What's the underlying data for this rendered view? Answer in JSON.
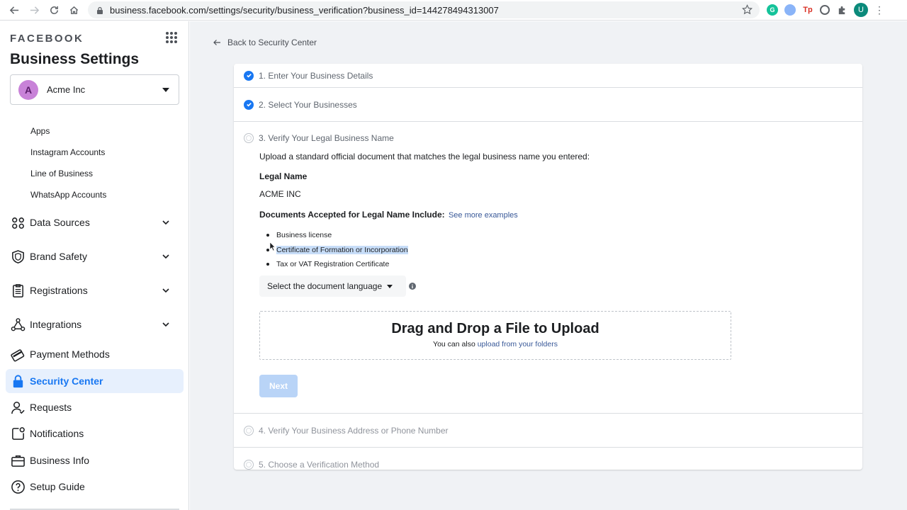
{
  "browser": {
    "url": "business.facebook.com/settings/security/business_verification?business_id=144278494313007",
    "profile_initial": "U",
    "ext_grammarly": "G",
    "ext_tp": "Tp"
  },
  "sidebar": {
    "brand": "FACEBOOK",
    "title": "Business Settings",
    "account": {
      "initial": "A",
      "name": "Acme Inc"
    },
    "sub_items": [
      "Apps",
      "Instagram Accounts",
      "Line of Business",
      "WhatsApp Accounts"
    ],
    "nav": [
      {
        "label": "Data Sources",
        "icon": "data-sources-icon",
        "expandable": true
      },
      {
        "label": "Brand Safety",
        "icon": "shield-icon",
        "expandable": true
      },
      {
        "label": "Registrations",
        "icon": "clipboard-icon",
        "expandable": true
      },
      {
        "label": "Integrations",
        "icon": "integrations-icon",
        "expandable": true
      },
      {
        "label": "Payment Methods",
        "icon": "credit-card-icon",
        "expandable": false
      },
      {
        "label": "Security Center",
        "icon": "lock-icon",
        "expandable": false,
        "active": true
      },
      {
        "label": "Requests",
        "icon": "person-icon",
        "expandable": false
      },
      {
        "label": "Notifications",
        "icon": "bell-icon",
        "expandable": false
      },
      {
        "label": "Business Info",
        "icon": "briefcase-icon",
        "expandable": false
      },
      {
        "label": "Setup Guide",
        "icon": "question-icon",
        "expandable": false
      }
    ]
  },
  "main": {
    "back_link": "Back to Security Center",
    "steps": [
      {
        "label": "1. Enter Your Business Details",
        "status": "done"
      },
      {
        "label": "2. Select Your Businesses",
        "status": "done"
      },
      {
        "label": "3. Verify Your Legal Business Name",
        "status": "current"
      },
      {
        "label": "4. Verify Your Business Address or Phone Number",
        "status": "pending"
      },
      {
        "label": "5. Choose a Verification Method",
        "status": "pending"
      }
    ],
    "step3": {
      "instruction": "Upload a standard official document that matches the legal business name you entered:",
      "legal_name_label": "Legal Name",
      "legal_name_value": "ACME INC",
      "docs_heading": "Documents Accepted for Legal Name Include:",
      "see_more": "See more examples",
      "documents": [
        "Business license",
        "Certificate of Formation or Incorporation",
        "Tax or VAT Registration Certificate"
      ],
      "language_select": "Select the document language",
      "dropzone_title": "Drag and Drop a File to Upload",
      "dropzone_sub_prefix": "You can also",
      "dropzone_link": "upload from your folders",
      "next_button": "Next"
    }
  },
  "colors": {
    "accent": "#1877f2",
    "active_bg": "#e7f0fd",
    "page_bg": "#f0f2f5",
    "link": "#385898"
  }
}
